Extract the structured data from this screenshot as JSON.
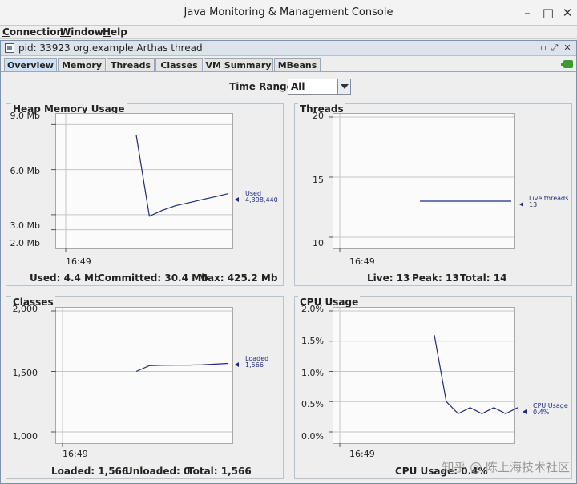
{
  "window": {
    "title": "Java Monitoring & Management Console"
  },
  "menu": [
    "Connection",
    "Window",
    "Help"
  ],
  "internal_frame": {
    "title": "pid: 33923 org.example.Arthas thread"
  },
  "tabs": [
    {
      "label": "Overview",
      "active": true
    },
    {
      "label": "Memory",
      "active": false
    },
    {
      "label": "Threads",
      "active": false
    },
    {
      "label": "Classes",
      "active": false
    },
    {
      "label": "VM Summary",
      "active": false
    },
    {
      "label": "MBeans",
      "active": false
    }
  ],
  "time_range": {
    "label": "Time Range:",
    "value": "All"
  },
  "colors": {
    "series": "#1f2a78",
    "panel_border": "#b9c3d0",
    "tab_active": "#cfe1f5"
  },
  "panels": {
    "heap": {
      "title": "Heap Memory Usage",
      "yticks": [
        "9.0 Mb",
        "6.0 Mb",
        "3.0 Mb",
        "2.0 Mb"
      ],
      "xtick": "16:49",
      "legend": {
        "name": "Used",
        "value": "4,398,440"
      },
      "footer": [
        "Used: 4.4 Mb",
        "Committed: 30.4 Mb",
        "Max: 425.2 Mb"
      ]
    },
    "threads": {
      "title": "Threads",
      "yticks": [
        "20",
        "15",
        "10"
      ],
      "xtick": "16:49",
      "legend": {
        "name": "Live threads",
        "value": "13"
      },
      "footer": [
        "Live: 13",
        "Peak: 13",
        "Total: 14"
      ]
    },
    "classes": {
      "title": "Classes",
      "yticks": [
        "2,000",
        "1,500",
        "1,000"
      ],
      "xtick": "16:49",
      "legend": {
        "name": "Loaded",
        "value": "1,566"
      },
      "footer": [
        "Loaded: 1,566",
        "Unloaded: 0",
        "Total: 1,566"
      ]
    },
    "cpu": {
      "title": "CPU Usage",
      "yticks": [
        "2.0%",
        "1.5%",
        "1.0%",
        "0.5%",
        "0.0%"
      ],
      "xtick": "16:49",
      "legend": {
        "name": "CPU Usage",
        "value": "0.4%"
      },
      "footer": [
        "CPU Usage: 0.4%"
      ]
    }
  },
  "chart_data": [
    {
      "type": "line",
      "title": "Heap Memory Usage",
      "ylabel": "",
      "ylim": [
        1.5,
        9.5
      ],
      "y_unit": "Mb",
      "x_tick": "16:49",
      "series": [
        {
          "name": "Used",
          "x": [
            0,
            1,
            2,
            3,
            4,
            5,
            6,
            7
          ],
          "values": [
            8.3,
            2.9,
            3.3,
            3.6,
            3.8,
            4.0,
            4.2,
            4.4
          ]
        }
      ]
    },
    {
      "type": "line",
      "title": "Threads",
      "ylabel": "",
      "ylim": [
        10,
        20
      ],
      "x_tick": "16:49",
      "series": [
        {
          "name": "Live threads",
          "x": [
            0,
            7
          ],
          "values": [
            13,
            13
          ]
        }
      ]
    },
    {
      "type": "line",
      "title": "Classes",
      "ylabel": "",
      "ylim": [
        1000,
        2000
      ],
      "x_tick": "16:49",
      "series": [
        {
          "name": "Loaded",
          "x": [
            0,
            1,
            2,
            3,
            4,
            5,
            6,
            7
          ],
          "values": [
            1500,
            1548,
            1551,
            1552,
            1552,
            1555,
            1560,
            1566
          ]
        }
      ]
    },
    {
      "type": "line",
      "title": "CPU Usage",
      "ylabel": "",
      "ylim": [
        0,
        2.0
      ],
      "y_unit": "%",
      "x_tick": "16:49",
      "series": [
        {
          "name": "CPU Usage",
          "x": [
            0,
            1,
            2,
            3,
            4,
            5,
            6,
            7
          ],
          "values": [
            1.6,
            0.5,
            0.3,
            0.4,
            0.3,
            0.4,
            0.3,
            0.4
          ]
        }
      ]
    }
  ],
  "watermark": "知乎 @ 陈上海技术社区"
}
